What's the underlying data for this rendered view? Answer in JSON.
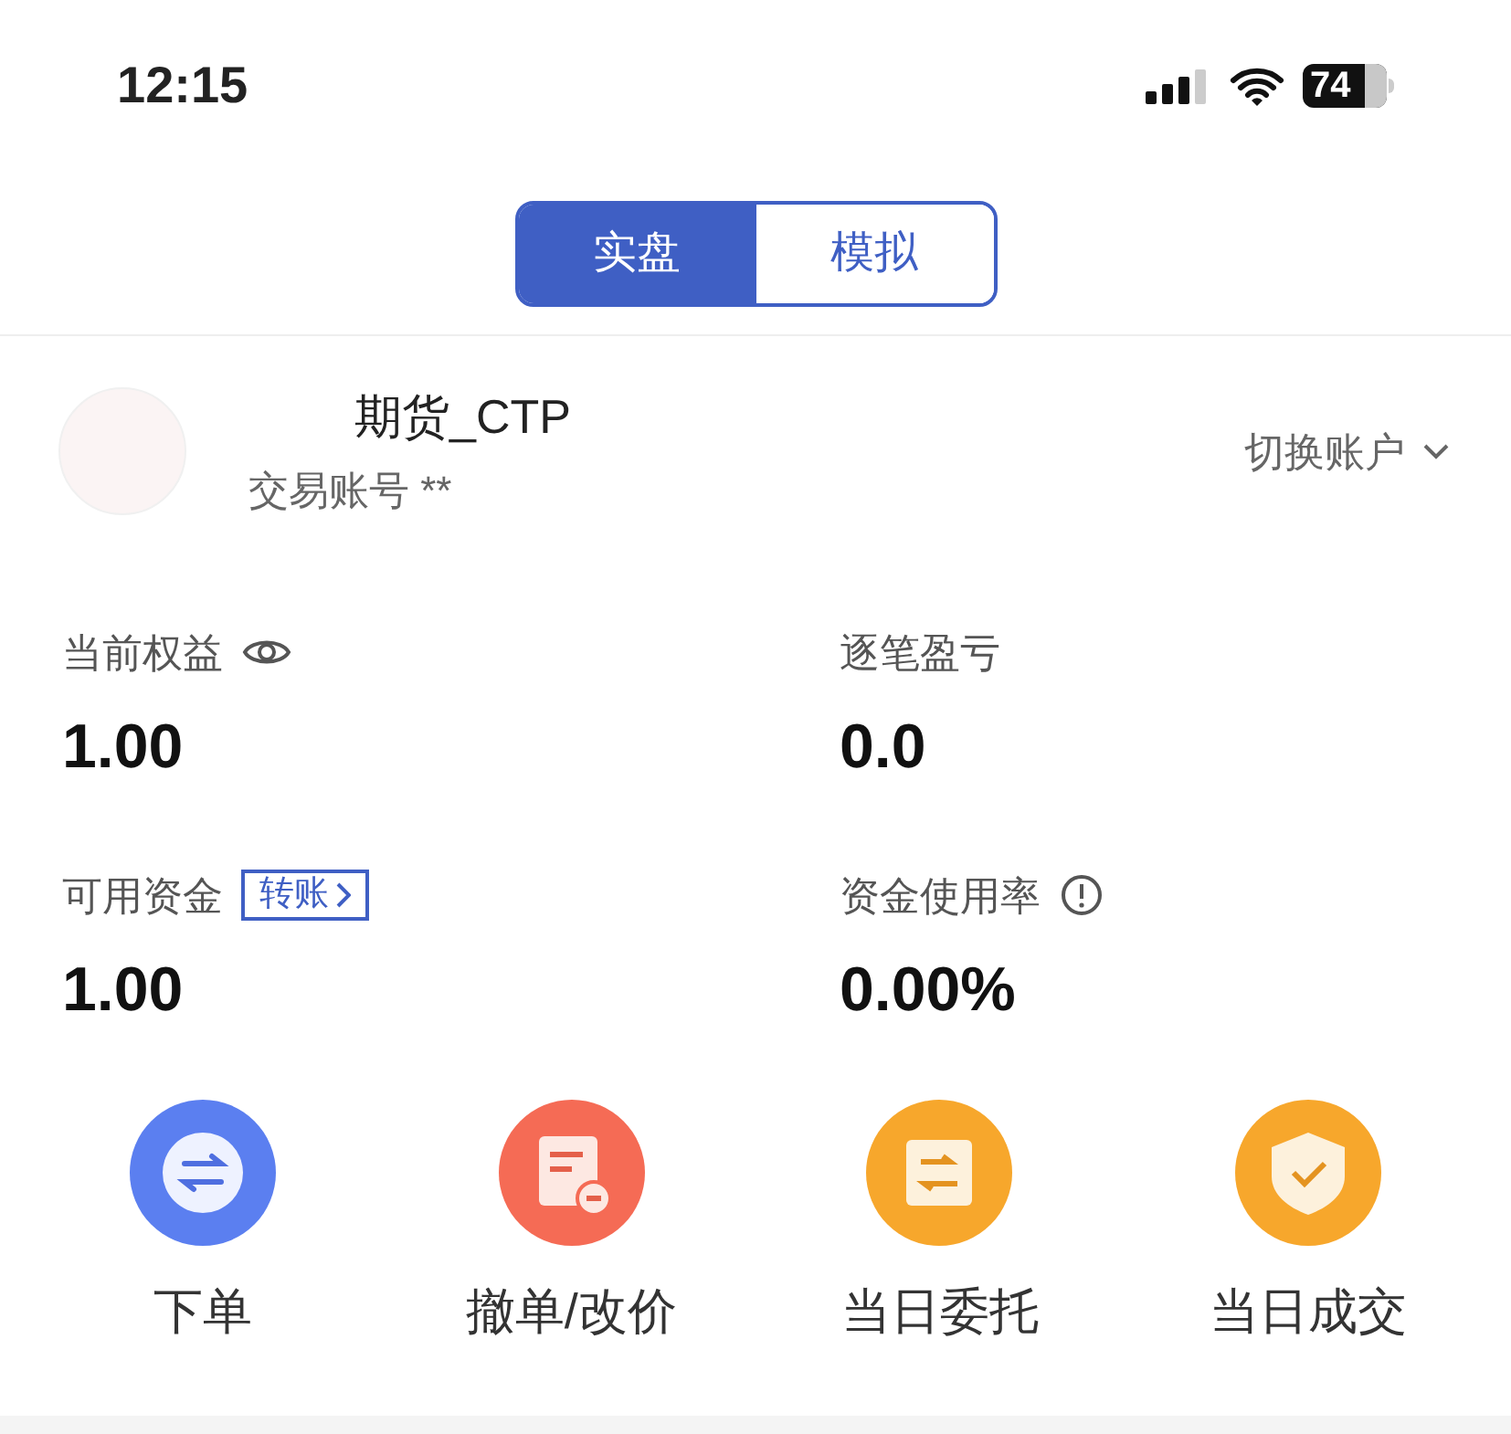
{
  "status_bar": {
    "time": "12:15",
    "battery": "74"
  },
  "mode_tabs": [
    {
      "label": "实盘",
      "selected": true
    },
    {
      "label": "模拟",
      "selected": false
    }
  ],
  "account": {
    "name": "期货_CTP",
    "number": "交易账号 **",
    "switch_label": "切换账户"
  },
  "stats": [
    {
      "label": "当前权益",
      "value": "1.00",
      "kind": "eye"
    },
    {
      "label": "逐笔盈亏",
      "value": "0.0",
      "kind": "plain"
    },
    {
      "label": "可用资金",
      "value": "1.00",
      "kind": "transfer",
      "action": "转账"
    },
    {
      "label": "资金使用率",
      "value": "0.00%",
      "kind": "info"
    }
  ],
  "actions": [
    {
      "label": "下单",
      "kind": "order",
      "color": "#5b7ff0"
    },
    {
      "label": "撤单/改价",
      "kind": "cancel",
      "color": "#f56b55"
    },
    {
      "label": "当日委托",
      "kind": "entrust",
      "color": "#f7a72c"
    },
    {
      "label": "当日成交",
      "kind": "deal",
      "color": "#f7a72c"
    }
  ]
}
